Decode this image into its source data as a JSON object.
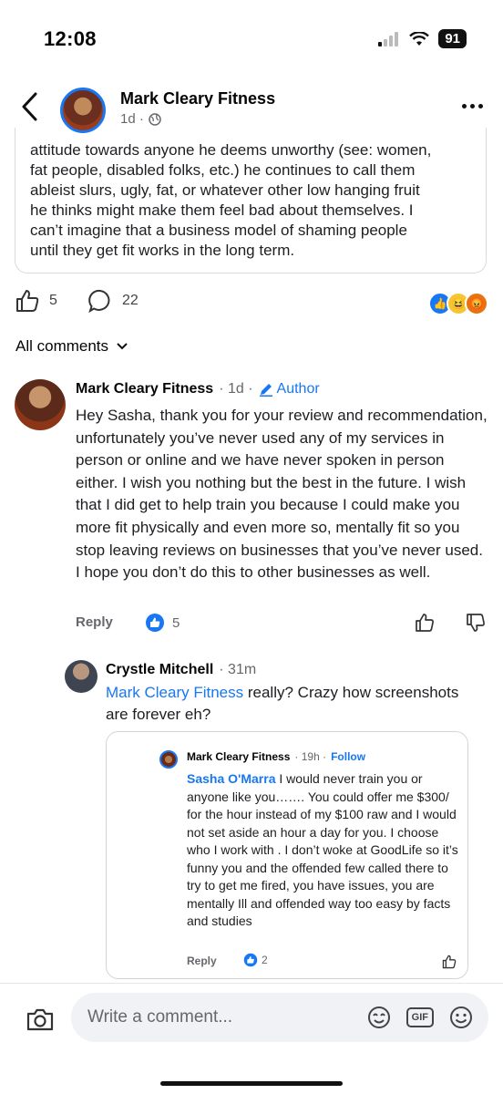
{
  "status": {
    "time": "12:08",
    "battery": "91"
  },
  "header": {
    "page_name": "Mark Cleary Fitness",
    "time": "1d ·"
  },
  "review": {
    "text": "attitude towards anyone he deems unworthy (see: women,\nfat people, disabled folks, etc.) he continues to call them\nableist slurs, ugly, fat, or whatever other low hanging fruit\nhe thinks might make them feel bad about themselves. I\ncan’t imagine that a business model of shaming people\nuntil they get fit works in the long term.",
    "likes": "5",
    "comments": "22"
  },
  "comments_filter": "All comments",
  "comment1": {
    "name": "Mark Cleary Fitness",
    "time": "· 1d ·",
    "badge": "Author",
    "text": "Hey Sasha, thank you for your review and recommendation, unfortunately you’ve never used any of my services in person or online and we have never spoken in person either. I wish you nothing but the best in the future. I wish that I did get to help train you because I could make you more fit physically and even more so,  mentally fit so you stop leaving reviews on businesses that you’ve never used. I hope you don’t do this to other businesses as well.",
    "reply": "Reply",
    "likes": "5"
  },
  "comment2": {
    "name": "Crystle Mitchell",
    "time": "· 31m",
    "mention": "Mark Cleary Fitness",
    "text": " really? Crazy how screenshots are forever eh?"
  },
  "embedded": {
    "name": "Mark Cleary Fitness",
    "time": "· 19h ·",
    "follow": "Follow",
    "mention": "Sasha O'Marra",
    "text": " I would never train you or anyone like you……. You could offer me $300/ for the hour instead of my $100 raw and I would not set aside an hour a day for you. I choose who I work with . I don’t woke at GoodLife so it’s funny you and the offended few called there to try to get me fired, you have issues, you are mentally Ill and offended way too easy by facts and studies",
    "reply": "Reply",
    "likes": "2"
  },
  "composer": {
    "placeholder": "Write a comment..."
  },
  "colors": {
    "accent": "#1877f2",
    "secondary_text": "#65676b"
  }
}
